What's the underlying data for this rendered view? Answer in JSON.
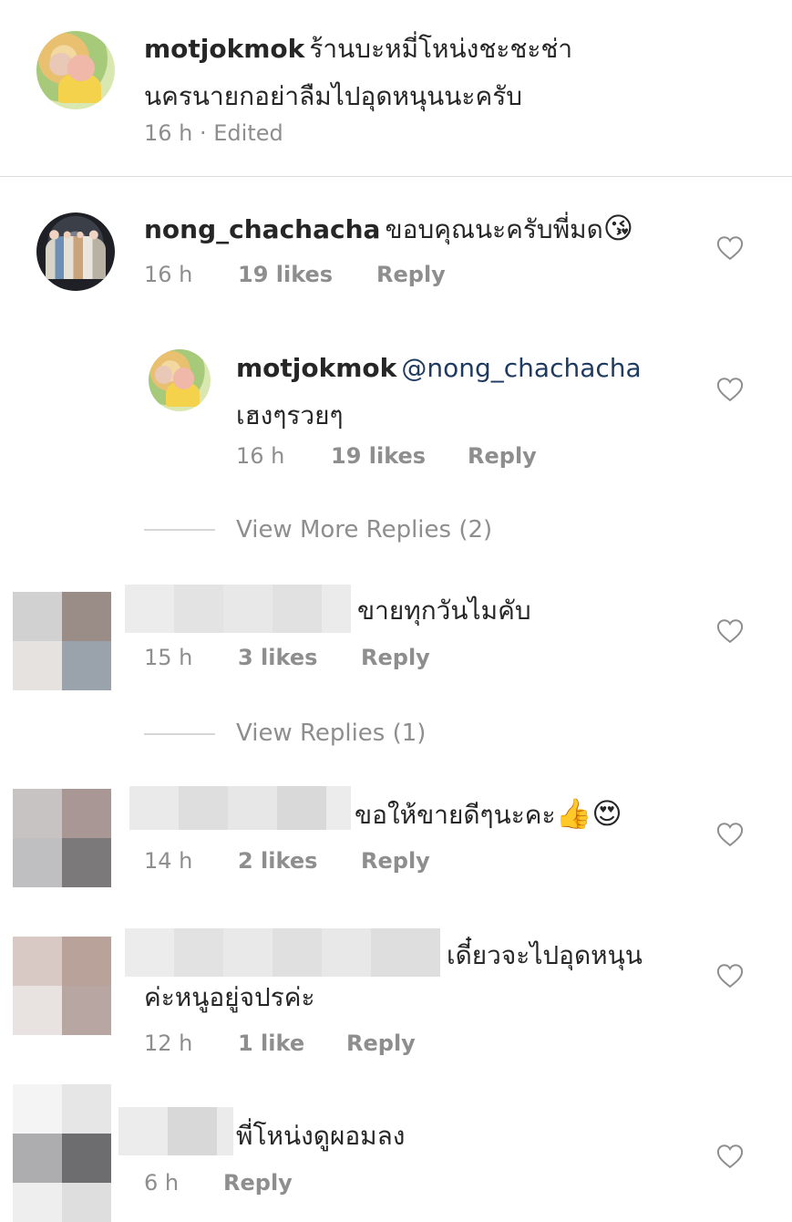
{
  "colors": {
    "text": "#262626",
    "meta": "#8e8e8e",
    "mention": "#1e3a5f",
    "divider": "#dbdbdb"
  },
  "caption": {
    "username": "motjokmok",
    "text_line1": "ร้านบะหมี่โหน่งชะชะช่า",
    "text_line2": "นครนายกอย่าลืมไปอุดหนุนนะครับ",
    "time": "16 h · Edited"
  },
  "comments": [
    {
      "username": "nong_chachacha",
      "text": "ขอบคุณนะครับพี่มด",
      "emoji": "😘",
      "time": "16 h",
      "likes": "19 likes",
      "reply_label": "Reply"
    },
    {
      "username": "motjokmok",
      "mention": "@nong_chachacha",
      "text": "เฮงๆรวยๆ",
      "time": "16 h",
      "likes": "19 likes",
      "reply_label": "Reply"
    },
    {
      "view_replies": "View More Replies (2)"
    },
    {
      "text": "ขายทุกวันไมคับ",
      "time": "15 h",
      "likes": "3 likes",
      "reply_label": "Reply"
    },
    {
      "view_replies": "View Replies (1)"
    },
    {
      "text": "ขอให้ขายดีๆนะคะ",
      "emoji": "👍😍",
      "time": "14 h",
      "likes": "2 likes",
      "reply_label": "Reply"
    },
    {
      "text_line1": "เดี๋ยวจะไปอุดหนุน",
      "text_line2": "ค่ะหนูอยู่จปรค่ะ",
      "time": "12 h",
      "likes": "1 like",
      "reply_label": "Reply"
    },
    {
      "text": "พี่โหน่งดูผอมลง",
      "time": "6 h",
      "reply_label": "Reply"
    }
  ]
}
